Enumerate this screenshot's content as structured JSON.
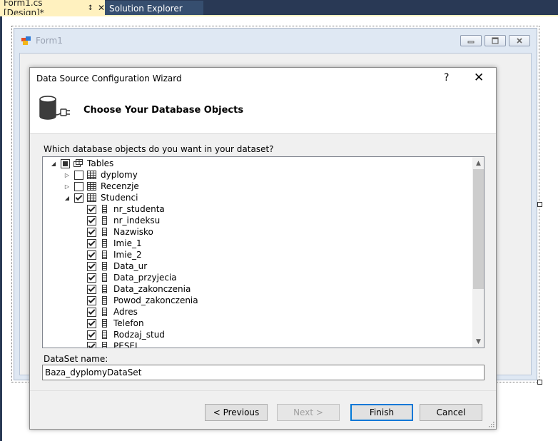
{
  "tabs": {
    "active": "Form1.cs [Design]*",
    "inactive": "Solution Explorer",
    "pin_icon": "pin-icon",
    "close_icon": "close-icon"
  },
  "form1": {
    "caption": "Form1"
  },
  "wizard": {
    "title": "Data Source Configuration Wizard",
    "help": "?",
    "close": "✕",
    "heading": "Choose Your Database Objects",
    "prompt": "Which database objects do you want in your dataset?",
    "tree": {
      "root": {
        "label": "Tables",
        "state": "partial",
        "expanded": true
      },
      "tables": [
        {
          "label": "dyplomy",
          "checked": false,
          "expanded": false
        },
        {
          "label": "Recenzje",
          "checked": false,
          "expanded": false
        },
        {
          "label": "Studenci",
          "checked": true,
          "expanded": true
        }
      ],
      "columns": [
        "nr_studenta",
        "nr_indeksu",
        "Nazwisko",
        "Imie_1",
        "Imie_2",
        "Data_ur",
        "Data_przyjecia",
        "Data_zakonczenia",
        "Powod_zakonczenia",
        "Adres",
        "Telefon",
        "Rodzaj_stud",
        "PESEL"
      ]
    },
    "dataset_label": "DataSet name:",
    "dataset_value": "Baza_dyplomyDataSet",
    "buttons": {
      "previous": "< Previous",
      "next": "Next >",
      "finish": "Finish",
      "cancel": "Cancel"
    }
  },
  "colors": {
    "vs_background": "#293955",
    "active_tab": "#fff1bf",
    "default_button_border": "#0078d7"
  }
}
